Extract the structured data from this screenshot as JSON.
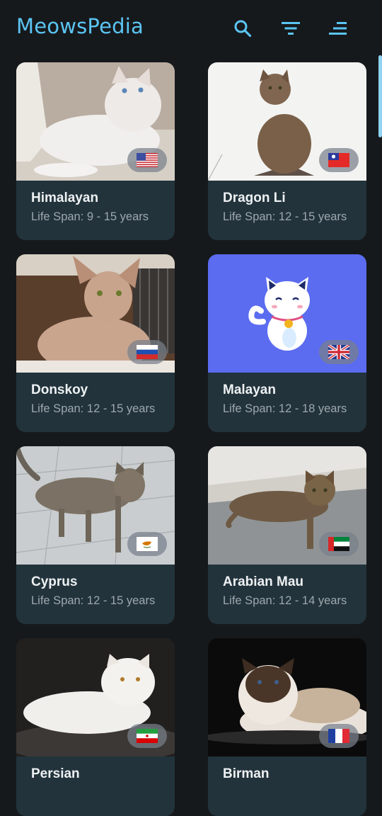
{
  "app": {
    "title": "MeowsPedia"
  },
  "toolbar": {
    "icons": [
      "search-icon",
      "filter-icon",
      "sort-icon"
    ]
  },
  "colors": {
    "accent": "#5bc5f3",
    "background": "#16191c",
    "card": "#22333b",
    "subtext": "#9ea8ae"
  },
  "cats": [
    {
      "name": "Himalayan",
      "life_span": "Life Span: 9 - 15 years",
      "flag": "united-states"
    },
    {
      "name": "Dragon Li",
      "life_span": "Life Span: 12 - 15 years",
      "flag": "taiwan"
    },
    {
      "name": "Donskoy",
      "life_span": "Life Span: 12 - 15 years",
      "flag": "russia"
    },
    {
      "name": "Malayan",
      "life_span": "Life Span: 12 - 18 years",
      "flag": "united-kingdom"
    },
    {
      "name": "Cyprus",
      "life_span": "Life Span: 12 - 15 years",
      "flag": "cyprus"
    },
    {
      "name": "Arabian Mau",
      "life_span": "Life Span: 12 - 14 years",
      "flag": "united-arab-emirates"
    },
    {
      "name": "Persian",
      "life_span": "",
      "flag": "iran"
    },
    {
      "name": "Birman",
      "life_span": "",
      "flag": "france"
    }
  ]
}
